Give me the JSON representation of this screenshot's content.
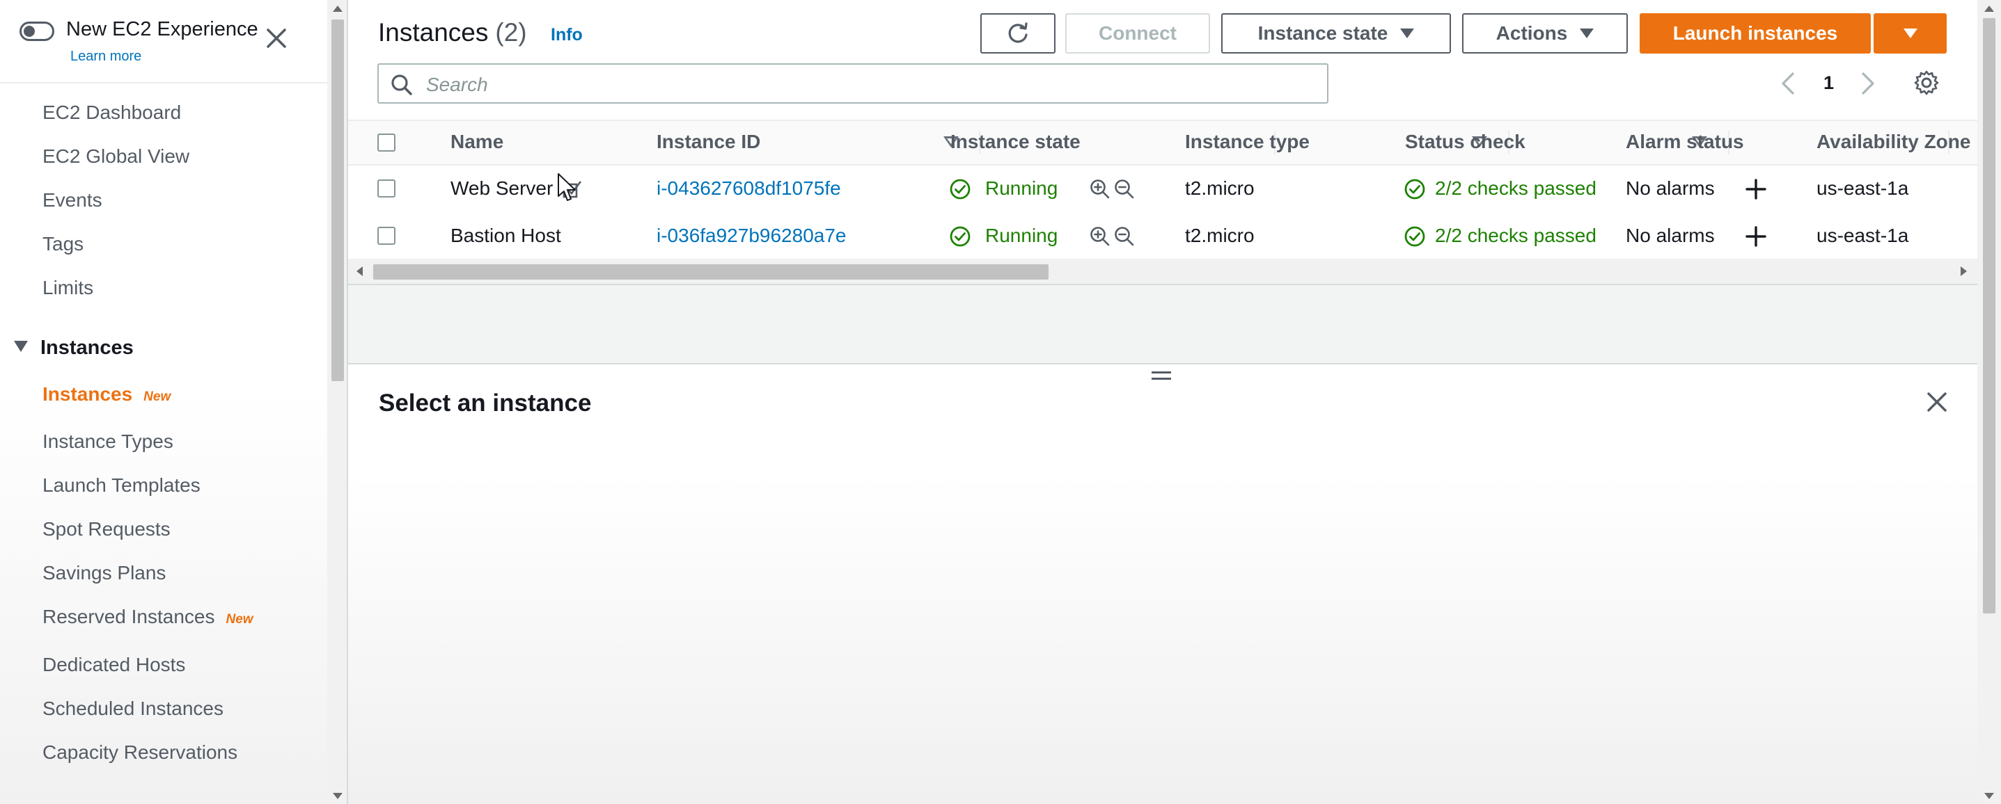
{
  "sidebar": {
    "experience_title": "New EC2 Experience",
    "learn_more": "Learn more",
    "top_links": [
      "EC2 Dashboard",
      "EC2 Global View",
      "Events",
      "Tags",
      "Limits"
    ],
    "section_title": "Instances",
    "section_items": [
      {
        "label": "Instances",
        "badge": "New",
        "active": true
      },
      {
        "label": "Instance Types",
        "badge": ""
      },
      {
        "label": "Launch Templates",
        "badge": ""
      },
      {
        "label": "Spot Requests",
        "badge": ""
      },
      {
        "label": "Savings Plans",
        "badge": ""
      },
      {
        "label": "Reserved Instances",
        "badge": "New"
      },
      {
        "label": "Dedicated Hosts",
        "badge": ""
      },
      {
        "label": "Scheduled Instances",
        "badge": ""
      },
      {
        "label": "Capacity Reservations",
        "badge": ""
      }
    ]
  },
  "header": {
    "title": "Instances",
    "count": "(2)",
    "info": "Info",
    "connect": "Connect",
    "instance_state": "Instance state",
    "actions": "Actions",
    "launch": "Launch instances"
  },
  "search": {
    "placeholder": "Search"
  },
  "pagination": {
    "page": "1"
  },
  "table": {
    "columns": [
      "Name",
      "Instance ID",
      "Instance state",
      "Instance type",
      "Status check",
      "Alarm status",
      "Availability Zone"
    ],
    "rows": [
      {
        "name": "Web Server",
        "id": "i-043627608df1075fe",
        "state": "Running",
        "type": "t2.micro",
        "status": "2/2 checks passed",
        "alarm": "No alarms",
        "az": "us-east-1a"
      },
      {
        "name": "Bastion Host",
        "id": "i-036fa927b96280a7e",
        "state": "Running",
        "type": "t2.micro",
        "status": "2/2 checks passed",
        "alarm": "No alarms",
        "az": "us-east-1a"
      }
    ]
  },
  "detail": {
    "title": "Select an instance"
  },
  "colors": {
    "accent": "#ec7211",
    "link": "#0073bb",
    "success": "#1d8102"
  }
}
